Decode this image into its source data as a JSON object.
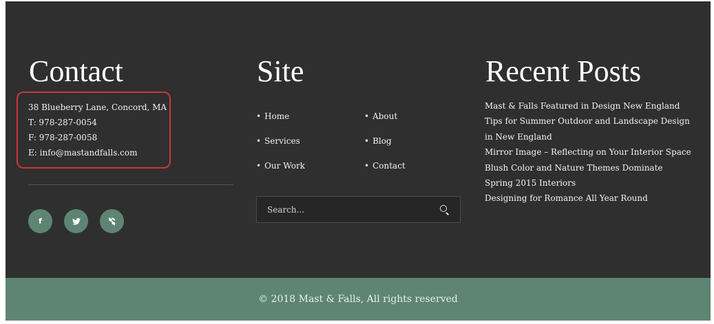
{
  "contact": {
    "title": "Contact",
    "address": "38 Blueberry Lane, Concord, MA",
    "phone": "T: 978-287-0054",
    "fax": "F: 978-287-0058",
    "email": "E: info@mastandfalls.com",
    "social": [
      {
        "icon": "facebook-icon",
        "glyph": "f"
      },
      {
        "icon": "twitter-icon",
        "glyph": "♥"
      },
      {
        "icon": "houzz-icon",
        "glyph": "h"
      }
    ]
  },
  "site": {
    "title": "Site",
    "nav": [
      "Home",
      "About",
      "Services",
      "Blog",
      "Our Work",
      "Contact"
    ],
    "search_placeholder": "Search..."
  },
  "recent_posts": {
    "title": "Recent Posts",
    "items": [
      "Mast & Falls Featured in Design New England",
      "Tips for Summer Outdoor and Landscape Design in New England",
      "Mirror Image – Reflecting on Your Interior Space",
      "Blush Color and Nature Themes Dominate Spring 2015 Interiors",
      "Designing for Romance All Year Round"
    ]
  },
  "copyright": "© 2018 Mast & Falls, All rights reserved",
  "colors": {
    "background": "#2f2f2f",
    "accent": "#5e8574",
    "highlight_border": "#c8383a"
  }
}
